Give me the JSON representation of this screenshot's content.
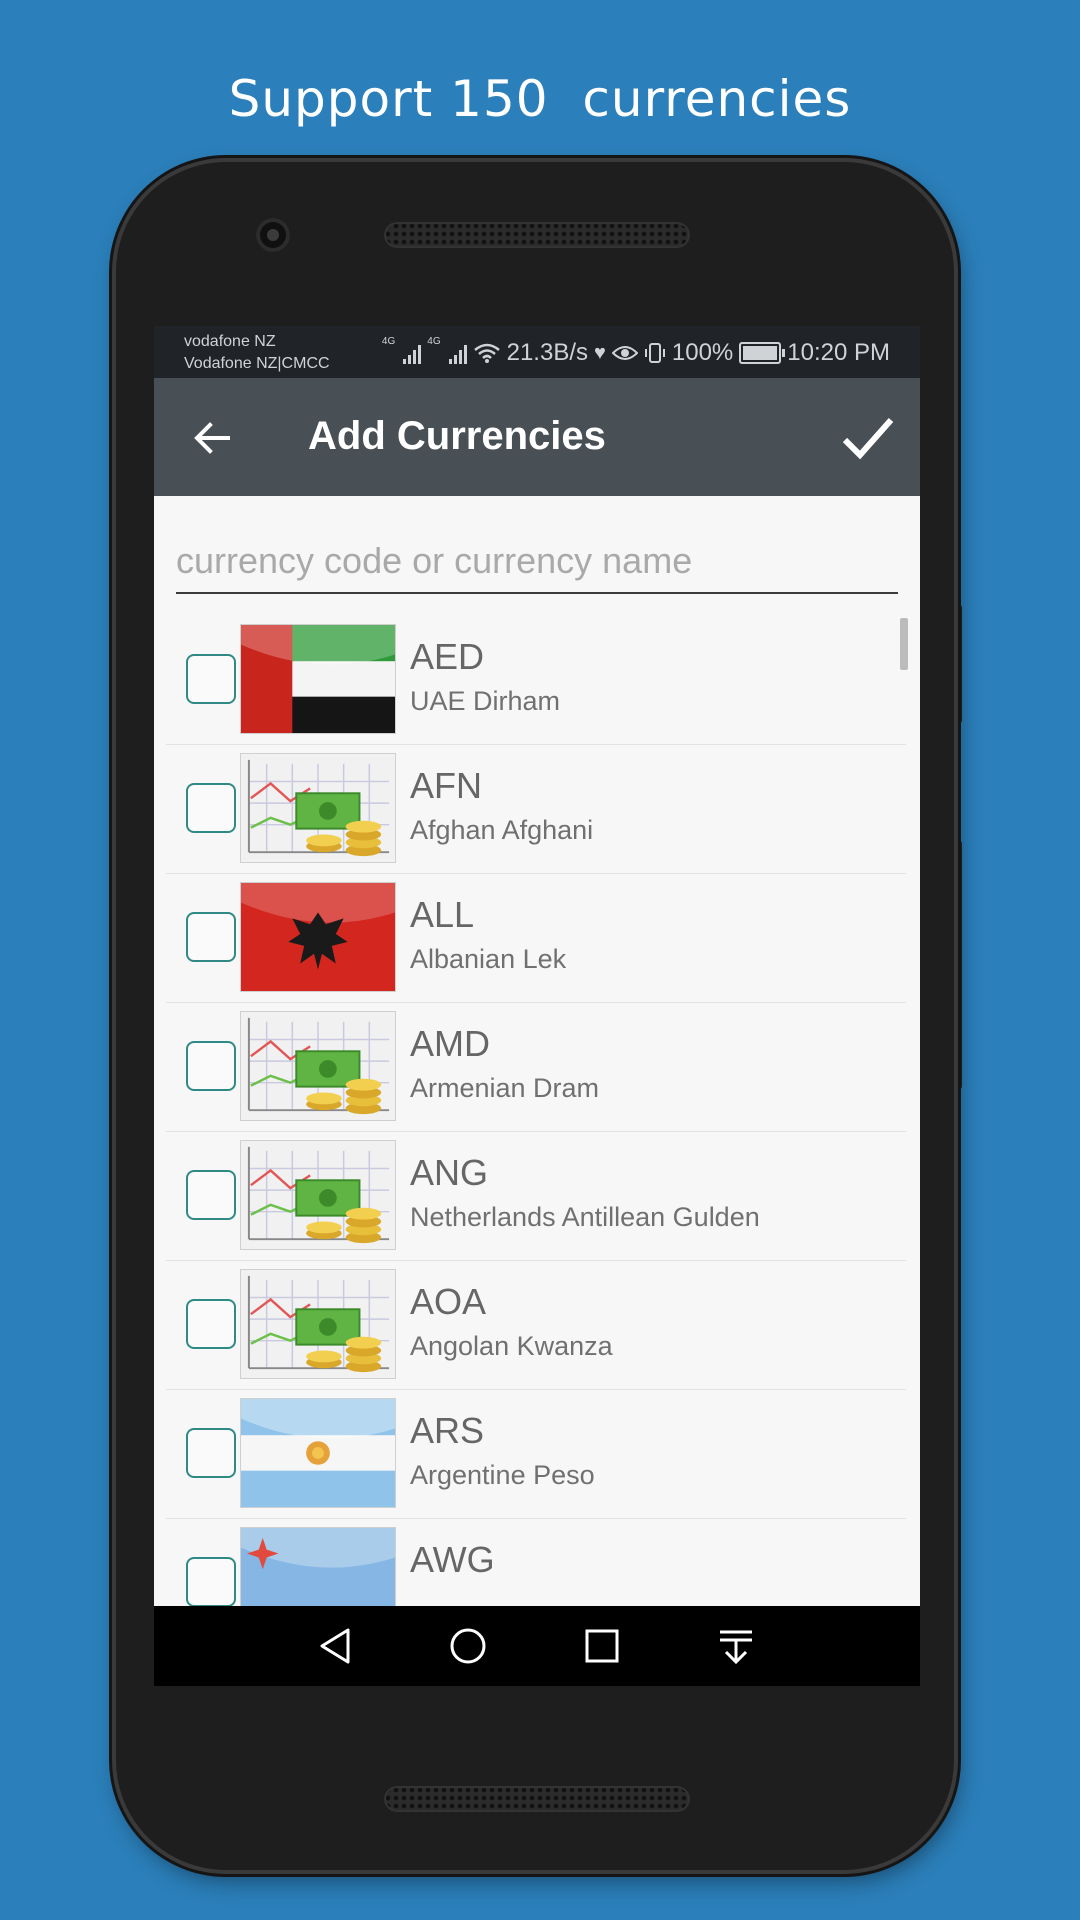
{
  "headline": "Support 150  currencies",
  "status_bar": {
    "carrier_line1": "vodafone NZ",
    "carrier_line2": "Vodafone NZ|CMCC",
    "net1": "4G",
    "net2": "4G",
    "speed": "21.3B/s",
    "battery": "100%",
    "time": "10:20 PM"
  },
  "app_bar": {
    "title": "Add Currencies",
    "back_icon": "arrow-left-icon",
    "confirm_icon": "checkmark-icon"
  },
  "search": {
    "placeholder": "currency code or currency name",
    "value": ""
  },
  "currencies": [
    {
      "code": "AED",
      "name": "UAE Dirham",
      "flag": "uae-flag-icon",
      "checked": false
    },
    {
      "code": "AFN",
      "name": "Afghan Afghani",
      "flag": "generic-money-icon",
      "checked": false
    },
    {
      "code": "ALL",
      "name": "Albanian Lek",
      "flag": "albania-flag-icon",
      "checked": false
    },
    {
      "code": "AMD",
      "name": "Armenian Dram",
      "flag": "generic-money-icon",
      "checked": false
    },
    {
      "code": "ANG",
      "name": "Netherlands Antillean Gulden",
      "flag": "generic-money-icon",
      "checked": false
    },
    {
      "code": "AOA",
      "name": "Angolan Kwanza",
      "flag": "generic-money-icon",
      "checked": false
    },
    {
      "code": "ARS",
      "name": "Argentine Peso",
      "flag": "argentina-flag-icon",
      "checked": false
    },
    {
      "code": "AWG",
      "name": "",
      "flag": "aruba-flag-icon",
      "checked": false
    }
  ],
  "nav_bar": [
    "back-triangle-icon",
    "home-circle-icon",
    "recents-square-icon",
    "notification-pull-down-icon"
  ],
  "colors": {
    "background": "#2b7fba",
    "app_bar": "#495055",
    "status_bar": "#202428",
    "checkbox_border": "#2f8a86"
  }
}
